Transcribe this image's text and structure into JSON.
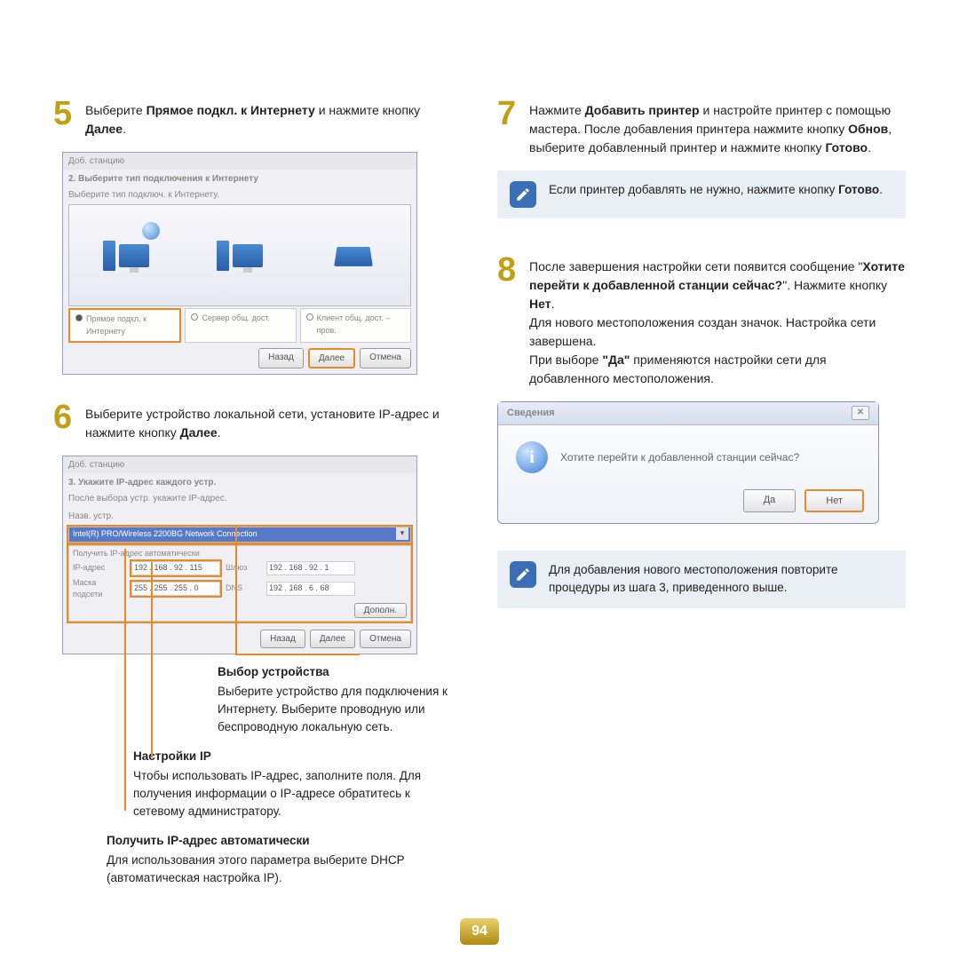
{
  "page_number": "94",
  "left": {
    "step5": {
      "num": "5",
      "text_pre": "Выберите ",
      "bold1": "Прямое подкл. к Интернету",
      "text_mid": " и нажмите кнопку ",
      "bold2": "Далее",
      "text_post": "."
    },
    "shot1": {
      "title": "Доб. станцию",
      "heading": "2. Выберите тип подключения к Интернету",
      "sub": "Выберите тип подключ. к Интернету.",
      "opt1": "Прямое подкл. к Интернету",
      "opt2": "Сервер общ. дост.",
      "opt3": "Клиент общ. дост. – пров.",
      "btn_back": "Назад",
      "btn_next": "Далее",
      "btn_cancel": "Отмена"
    },
    "step6": {
      "num": "6",
      "text_pre": "Выберите устройство локальной сети, установите IP-адрес и нажмите кнопку ",
      "bold": "Далее",
      "text_post": "."
    },
    "shot2": {
      "title": "Доб. станцию",
      "heading": "3. Укажите IP-адрес каждого устр.",
      "sub": "После выбора устр. укажите IP-адрес.",
      "lbl_dev": "Назв. устр.",
      "combo": "Intel(R) PRO/Wireless 2200BG Network Connection",
      "auto_ip": "Получить IP-адрес автоматически",
      "ip_lbl": "IP-адрес",
      "ip1": "192 . 168 . 92 . 115",
      "gw_lbl": "Шлюз",
      "ip2": "192 . 168 . 92 . 1",
      "mask_lbl": "Маска подсети",
      "mask": "255 . 255 . 255 . 0",
      "dns_lbl": "DNS",
      "dns": "192 . 168 . 6 . 68",
      "btn_more": "Дополн.",
      "btn_back": "Назад",
      "btn_next": "Далее",
      "btn_cancel": "Отмена"
    },
    "callout_device": {
      "h": "Выбор устройства",
      "t": "Выберите устройство для подключения к Интернету. Выберите проводную или беспроводную локальную сеть."
    },
    "callout_ip": {
      "h": "Настройки IP",
      "t": "Чтобы использовать IP-адрес, заполните поля. Для получения информации о IP-адресе обратитесь к сетевому администратору."
    },
    "callout_auto": {
      "h": "Получить IP-адрес автоматически",
      "t": "Для использования этого параметра выберите DHCP (автоматическая настройка IP)."
    }
  },
  "right": {
    "step7": {
      "num": "7",
      "text_a": "Нажмите ",
      "bold_a": "Добавить принтер",
      "text_b": " и настройте принтер с помощью мастера. После добавления принтера нажмите кнопку ",
      "bold_b": "Обнов",
      "text_c": ", выберите добавленный принтер и нажмите кнопку ",
      "bold_c": "Готово",
      "text_d": "."
    },
    "note1_a": "Если принтер добавлять не нужно, нажмите кнопку ",
    "note1_b": "Готово",
    "note1_c": ".",
    "step8": {
      "num": "8",
      "a": "После завершения настройки сети появится сообщение \"",
      "b": "Хотите перейти к добавленной станции сейчас?",
      "c": "\". Нажмите кнопку ",
      "d": "Нет",
      "e": ".",
      "f": "Для нового местоположения создан значок. Настройка сети завершена.",
      "g": "При выборе ",
      "h": "\"Да\"",
      "i": " применяются настройки сети для добавленного местоположения."
    },
    "dlg": {
      "title": "Сведения",
      "msg": "Хотите перейти к добавленной станции сейчас?",
      "yes": "Да",
      "no": "Нет"
    },
    "note2": "Для добавления нового местоположения повторите процедуры из шага 3, приведенного выше."
  }
}
